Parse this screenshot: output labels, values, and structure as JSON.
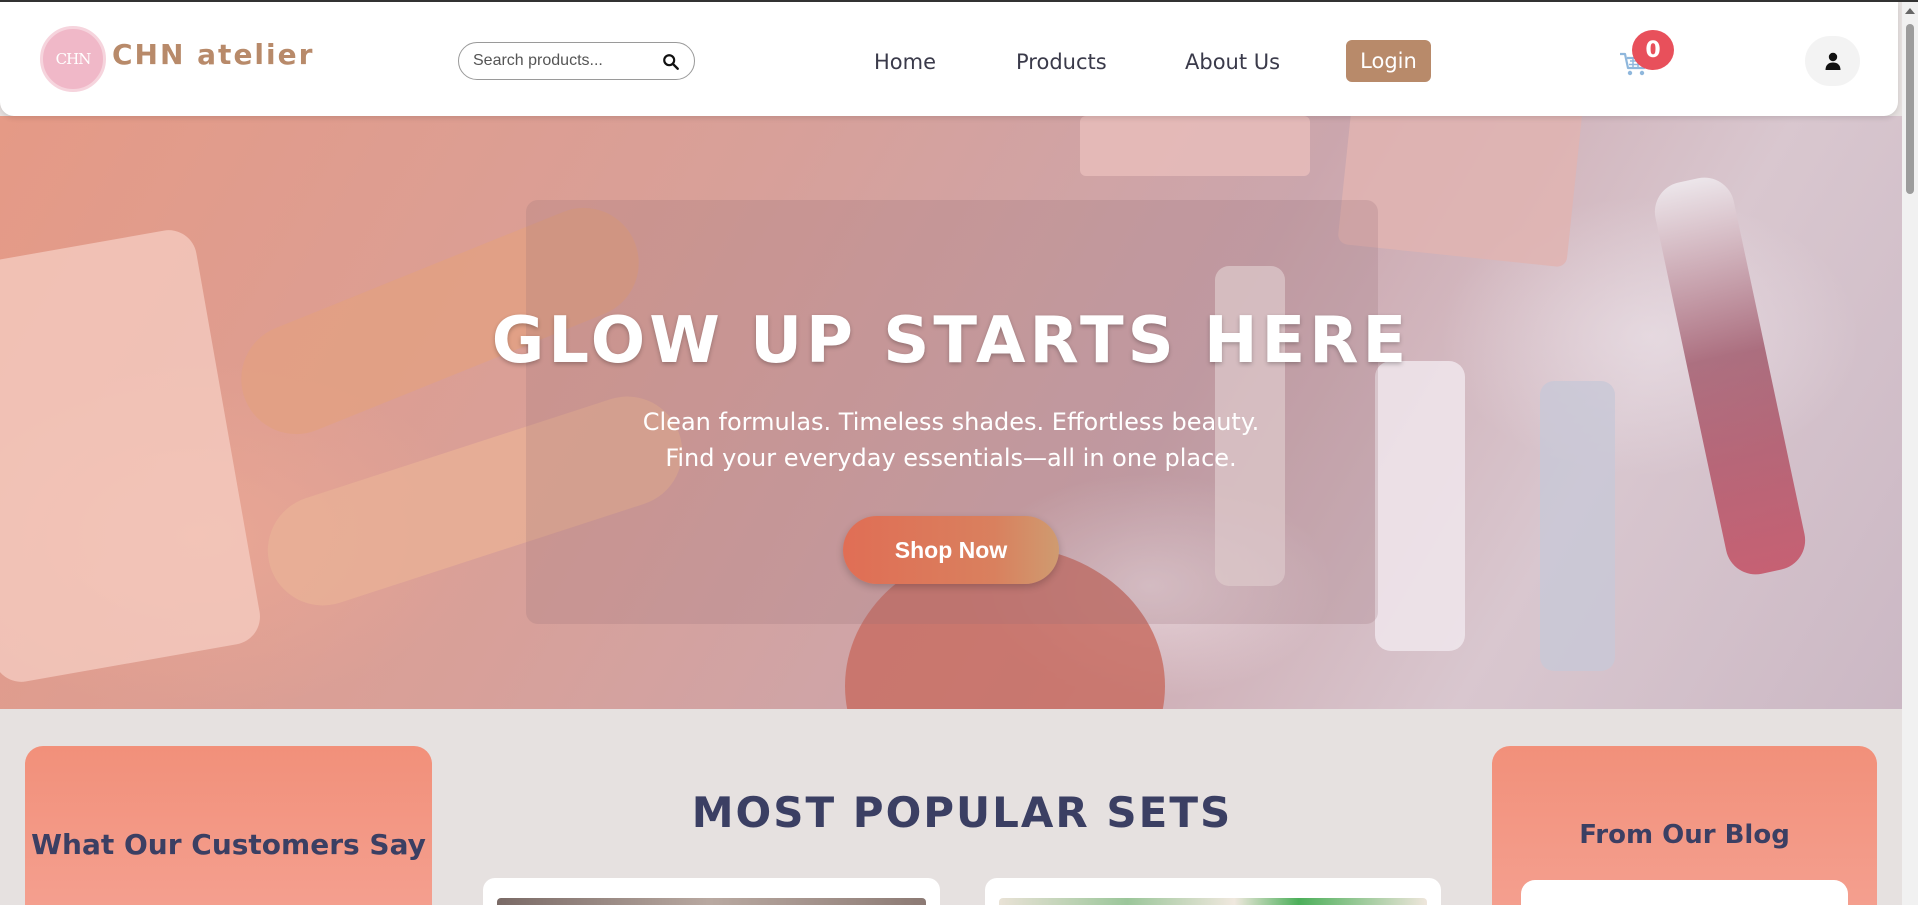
{
  "header": {
    "logo_text": "CHN",
    "brand": "CHN atelier",
    "search": {
      "placeholder": "Search products..."
    },
    "nav": {
      "home": "Home",
      "products": "Products",
      "about": "About Us"
    },
    "login_label": "Login",
    "cart_count": "0"
  },
  "hero": {
    "title": "GLOW UP STARTS HERE",
    "subtitle_line1": "Clean formulas. Timeless shades. Effortless beauty.",
    "subtitle_line2": "Find your everyday essentials—all in one place.",
    "cta_label": "Shop Now"
  },
  "sections": {
    "testimonials_title": "What Our Customers Say",
    "popular_title": "MOST POPULAR SETS",
    "blog_title": "From Our Blog"
  },
  "colors": {
    "brand": "#b88a6a",
    "accent": "#f2907a",
    "heading": "#3b3f63",
    "badge": "#e8505b"
  },
  "icons": {
    "search": "search-icon",
    "cart": "cart-icon",
    "user": "user-icon"
  }
}
